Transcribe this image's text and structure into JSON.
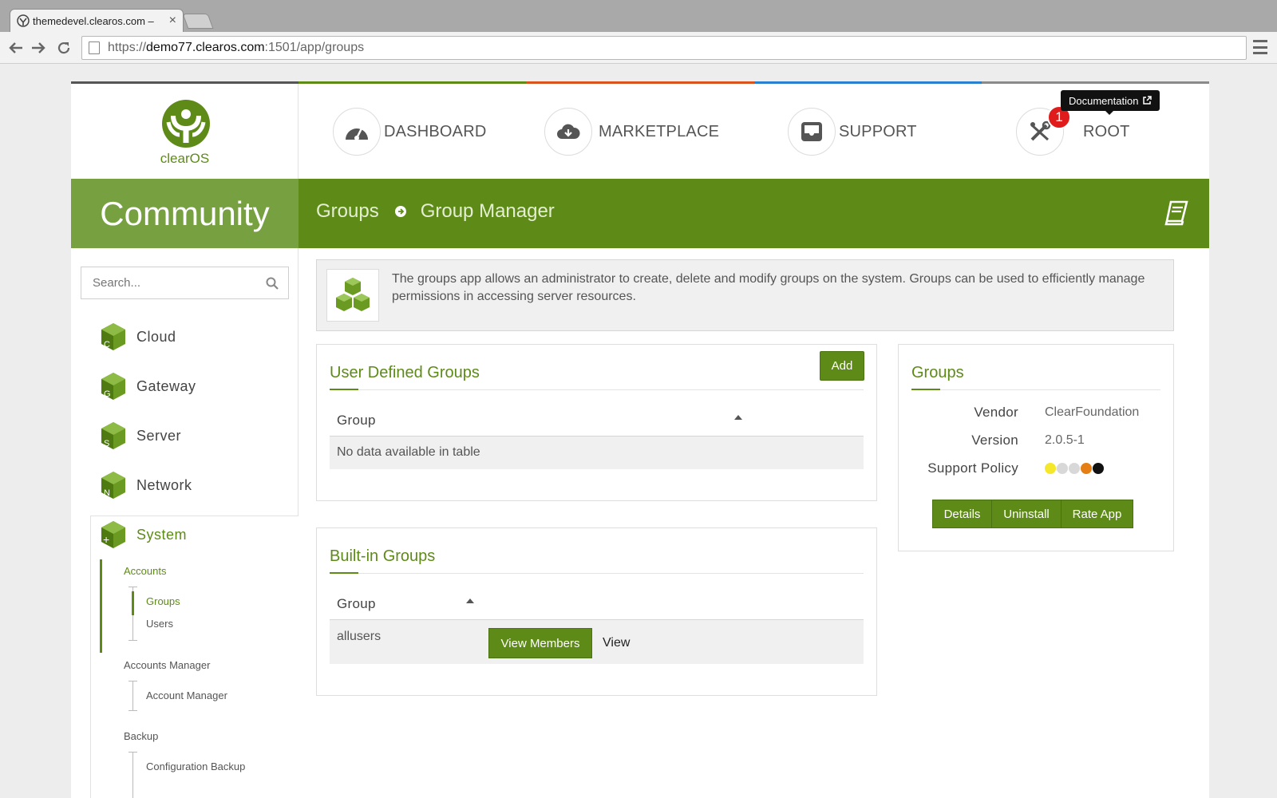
{
  "browser": {
    "tab_title": "themedevel.clearos.com –",
    "tab_close": "×",
    "url_scheme": "https://",
    "url_host": "demo77.clearos.com",
    "url_path": ":1501/app/groups"
  },
  "logo": {
    "text": "clearOS",
    "color": "#5e8b17"
  },
  "topnav": {
    "dashboard": "DASHBOARD",
    "marketplace": "MARKETPLACE",
    "support": "SUPPORT",
    "root": "ROOT",
    "root_badge": "1",
    "bar_colors": [
      "#555555",
      "#5e8b17",
      "#d9531e",
      "#2a7fce",
      "#8a8a8a"
    ]
  },
  "header": {
    "edition": "Community",
    "crumb_1": "Groups",
    "crumb_2": "Group Manager",
    "tooltip": "Documentation",
    "accent": "#5e8b17",
    "edition_bg": "#77a040"
  },
  "sidebar": {
    "search_placeholder": "Search...",
    "items": [
      {
        "label": "Cloud",
        "letter": "C"
      },
      {
        "label": "Gateway",
        "letter": "G"
      },
      {
        "label": "Server",
        "letter": "S"
      },
      {
        "label": "Network",
        "letter": "N"
      },
      {
        "label": "System",
        "letter": "+"
      }
    ],
    "system_sub": {
      "accounts": "Accounts",
      "groups": "Groups",
      "users": "Users",
      "accounts_manager": "Accounts Manager",
      "account_manager": "Account Manager",
      "backup": "Backup",
      "configuration_backup": "Configuration Backup"
    }
  },
  "intro": {
    "text": "The groups app allows an administrator to create, delete and modify groups on the system. Groups can be used to efficiently manage permissions in accessing server resources."
  },
  "user_groups": {
    "title": "User Defined Groups",
    "add_label": "Add",
    "column": "Group",
    "empty_text": "No data available in table"
  },
  "builtin_groups": {
    "title": "Built-in Groups",
    "column": "Group",
    "rows": [
      {
        "group": "allusers",
        "view_members": "View Members",
        "view": "View"
      }
    ]
  },
  "app_info": {
    "title": "Groups",
    "vendor_label": "Vendor",
    "vendor": "ClearFoundation",
    "version_label": "Version",
    "version": "2.0.5-1",
    "support_label": "Support Policy",
    "support_colors": [
      "#f5e82a",
      "#d8d8d8",
      "#d8d8d8",
      "#e57e14",
      "#111111"
    ],
    "details": "Details",
    "uninstall": "Uninstall",
    "rate": "Rate App"
  }
}
